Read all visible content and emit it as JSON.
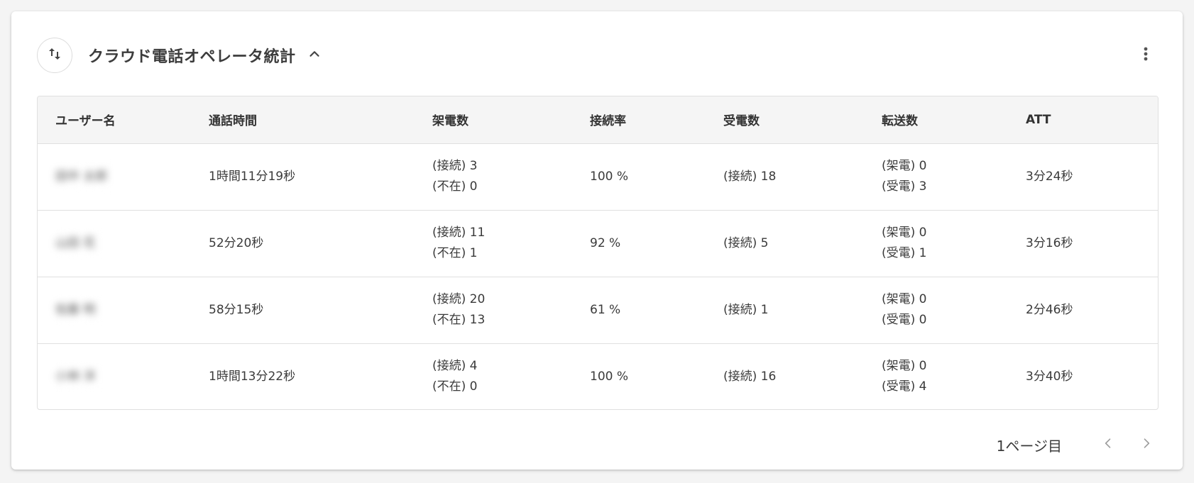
{
  "panel": {
    "title": "クラウド電話オペレータ統計",
    "icons": {
      "sort": "swap-vertical-icon",
      "collapse": "chevron-up-icon",
      "more": "more-vertical-icon"
    }
  },
  "table": {
    "columns": [
      "ユーザー名",
      "通話時間",
      "架電数",
      "接続率",
      "受電数",
      "転送数",
      "ATT"
    ],
    "rows": [
      {
        "user": "田中 太郎",
        "talk_time": "1時間11分19秒",
        "outgoing_connected": "(接続) 3",
        "outgoing_absent": "(不在) 0",
        "connect_rate": "100 %",
        "incoming": "(接続) 18",
        "transfer_outgoing": "(架電) 0",
        "transfer_incoming": "(受電) 3",
        "att": "3分24秒"
      },
      {
        "user": "山田 花",
        "talk_time": "52分20秒",
        "outgoing_connected": "(接続) 11",
        "outgoing_absent": "(不在) 1",
        "connect_rate": "92 %",
        "incoming": "(接続) 5",
        "transfer_outgoing": "(架電) 0",
        "transfer_incoming": "(受電) 1",
        "att": "3分16秒"
      },
      {
        "user": "佐藤 明",
        "talk_time": "58分15秒",
        "outgoing_connected": "(接続) 20",
        "outgoing_absent": "(不在) 13",
        "connect_rate": "61 %",
        "incoming": "(接続) 1",
        "transfer_outgoing": "(架電) 0",
        "transfer_incoming": "(受電) 0",
        "att": "2分46秒"
      },
      {
        "user": "小林 洋",
        "talk_time": "1時間13分22秒",
        "outgoing_connected": "(接続) 4",
        "outgoing_absent": "(不在) 0",
        "connect_rate": "100 %",
        "incoming": "(接続) 16",
        "transfer_outgoing": "(架電) 0",
        "transfer_incoming": "(受電) 4",
        "att": "3分40秒"
      }
    ]
  },
  "pagination": {
    "label": "1ページ目",
    "prev_icon": "chevron-left-icon",
    "next_icon": "chevron-right-icon"
  },
  "colors": {
    "card_background": "#ffffff",
    "page_background": "#f4f4f4",
    "header_row_background": "#f5f5f5",
    "text": "#3a3a3a",
    "border": "#e0e0e0",
    "disabled_icon": "#9e9e9e"
  }
}
